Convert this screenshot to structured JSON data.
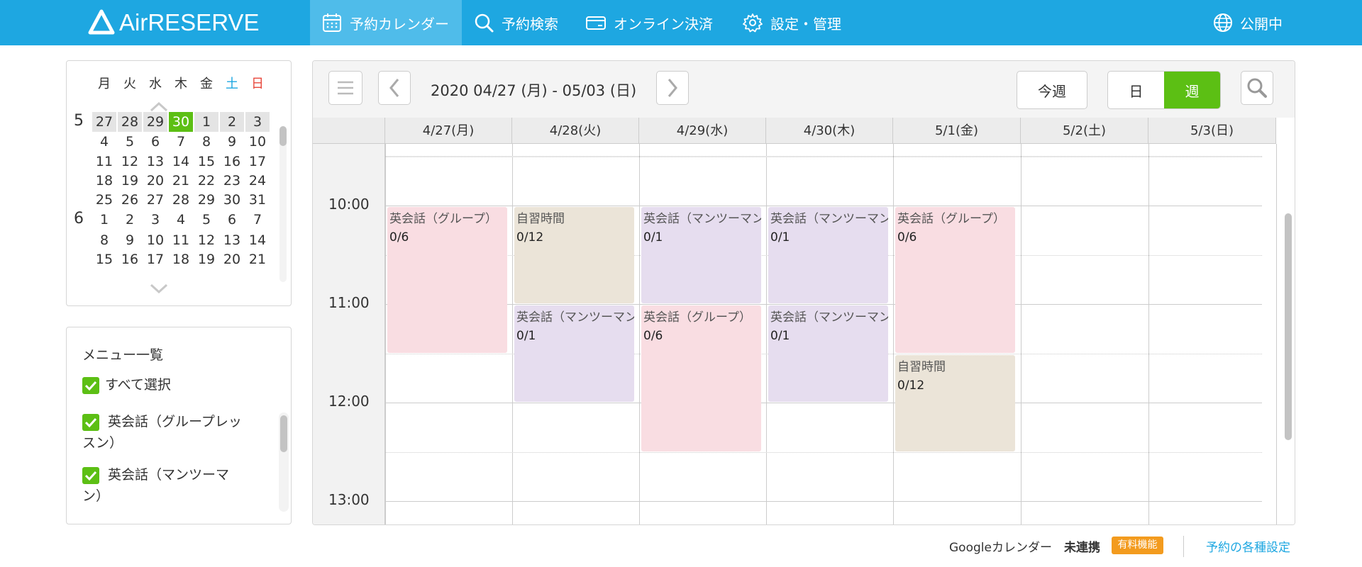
{
  "header": {
    "logo_text": "AirRESERVE",
    "nav": [
      {
        "label": "予約カレンダー",
        "icon": "calendar-icon",
        "active": true
      },
      {
        "label": "予約検索",
        "icon": "search-icon",
        "active": false
      },
      {
        "label": "オンライン決済",
        "icon": "wallet-icon",
        "active": false
      },
      {
        "label": "設定・管理",
        "icon": "gear-icon",
        "active": false
      }
    ],
    "status": {
      "label": "公開中",
      "icon": "globe-icon"
    }
  },
  "mini_calendar": {
    "weekdays": [
      "月",
      "火",
      "水",
      "木",
      "金",
      "土",
      "日"
    ],
    "weekday_colors": {
      "sat": "#1ea7e1",
      "sun": "#e8473b"
    },
    "rows": [
      {
        "month": "5",
        "days": [
          "27",
          "28",
          "29",
          "30",
          "1",
          "2",
          "3"
        ]
      },
      {
        "month": "",
        "days": [
          "4",
          "5",
          "6",
          "7",
          "8",
          "9",
          "10"
        ]
      },
      {
        "month": "",
        "days": [
          "11",
          "12",
          "13",
          "14",
          "15",
          "16",
          "17"
        ]
      },
      {
        "month": "",
        "days": [
          "18",
          "19",
          "20",
          "21",
          "22",
          "23",
          "24"
        ]
      },
      {
        "month": "",
        "days": [
          "25",
          "26",
          "27",
          "28",
          "29",
          "30",
          "31"
        ]
      },
      {
        "month": "6",
        "days": [
          "1",
          "2",
          "3",
          "4",
          "5",
          "6",
          "7"
        ]
      },
      {
        "month": "",
        "days": [
          "8",
          "9",
          "10",
          "11",
          "12",
          "13",
          "14"
        ]
      },
      {
        "month": "",
        "days": [
          "15",
          "16",
          "17",
          "18",
          "19",
          "20",
          "21"
        ]
      }
    ],
    "highlighted_row": 0,
    "selected_day": "30"
  },
  "menu_list": {
    "title": "メニュー一覧",
    "select_all": "すべて選択",
    "items": [
      {
        "label_line1": "英会話（グループレッ",
        "label_line2": "スン）",
        "checked": true
      },
      {
        "label_line1": "英会話（マンツーマ",
        "label_line2": "ン）",
        "checked": true
      }
    ]
  },
  "toolbar": {
    "range": "2020 04/27 (月) - 05/03 (日)",
    "this_week": "今週",
    "view_day": "日",
    "view_week": "週",
    "active_view": "週"
  },
  "days": [
    "4/27(月)",
    "4/28(火)",
    "4/29(水)",
    "4/30(木)",
    "5/1(金)",
    "5/2(土)",
    "5/3(日)"
  ],
  "times": [
    "10:00",
    "11:00",
    "12:00",
    "13:00"
  ],
  "events": [
    {
      "day": 0,
      "start": "10:00",
      "end": "11:30",
      "name": "英会話（グループ）",
      "count": "0/6",
      "color": "pink"
    },
    {
      "day": 1,
      "start": "10:00",
      "end": "11:00",
      "name": "自習時間",
      "count": "0/12",
      "color": "beige"
    },
    {
      "day": 1,
      "start": "11:00",
      "end": "12:00",
      "name": "英会話（マンツーマン）",
      "count": "0/1",
      "color": "purple"
    },
    {
      "day": 2,
      "start": "10:00",
      "end": "11:00",
      "name": "英会話（マンツーマン）",
      "count": "0/1",
      "color": "purple"
    },
    {
      "day": 2,
      "start": "11:00",
      "end": "12:30",
      "name": "英会話（グループ）",
      "count": "0/6",
      "color": "pink"
    },
    {
      "day": 3,
      "start": "10:00",
      "end": "11:00",
      "name": "英会話（マンツーマン）",
      "count": "0/1",
      "color": "purple"
    },
    {
      "day": 3,
      "start": "11:00",
      "end": "12:00",
      "name": "英会話（マンツーマン）",
      "count": "0/1",
      "color": "purple"
    },
    {
      "day": 4,
      "start": "10:00",
      "end": "11:30",
      "name": "英会話（グループ）",
      "count": "0/6",
      "color": "pink"
    },
    {
      "day": 4,
      "start": "11:30",
      "end": "12:30",
      "name": "自習時間",
      "count": "0/12",
      "color": "beige"
    }
  ],
  "footer": {
    "gcal_label": "Googleカレンダー",
    "gcal_status": "未連携",
    "badge": "有料機能",
    "settings_link": "予約の各種設定"
  },
  "colors": {
    "header": "#1ea7e1",
    "accent_green": "#5cbf14",
    "event_pink": "#f9dde2",
    "event_beige": "#ebe4d8",
    "event_purple": "#e6ddef",
    "badge_orange": "#f39b1e"
  }
}
